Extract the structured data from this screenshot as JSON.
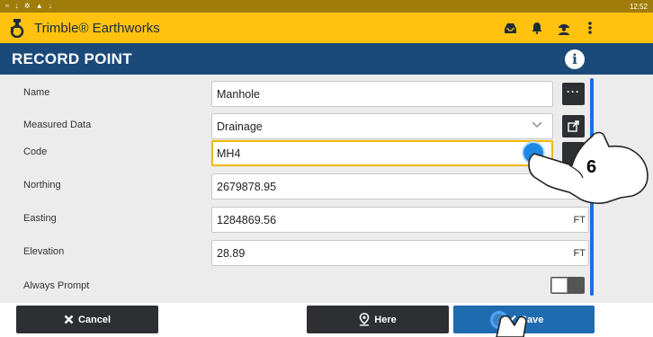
{
  "status_bar": {
    "time": "12:52",
    "icons": "≈ ↓ ✲ ▲ ↓"
  },
  "app_bar": {
    "title": "Trimble® Earthworks",
    "icons": [
      "trimble-logo-icon",
      "inbox-icon",
      "alert-bell-icon",
      "user-icon",
      "overflow-menu-icon"
    ]
  },
  "page": {
    "title": "RECORD POINT",
    "info_icon": "i"
  },
  "form": {
    "fields": [
      {
        "label": "Name",
        "value": "Manhole"
      },
      {
        "label": "Measured Data",
        "value": "Drainage"
      },
      {
        "label": "Code",
        "value": "MH4"
      },
      {
        "label": "Northing",
        "value": "2679878.95"
      },
      {
        "label": "Easting",
        "value": "1284869.56",
        "unit": "FT"
      },
      {
        "label": "Elevation",
        "value": "28.89",
        "unit": "FT"
      },
      {
        "label": "Always Prompt"
      }
    ],
    "name_button": "···",
    "always_prompt_on": false
  },
  "buttons": {
    "cancel": "Cancel",
    "here": "Here",
    "save": "Save"
  },
  "annotation": {
    "step": "6"
  },
  "colors": {
    "status_bar": "#a07d0b",
    "app_bar": "#ffc20e",
    "title_bar": "#1b4a7a",
    "dark_button": "#2d2f33",
    "save_button": "#1e6bb0",
    "focus_border": "#f2b705"
  }
}
